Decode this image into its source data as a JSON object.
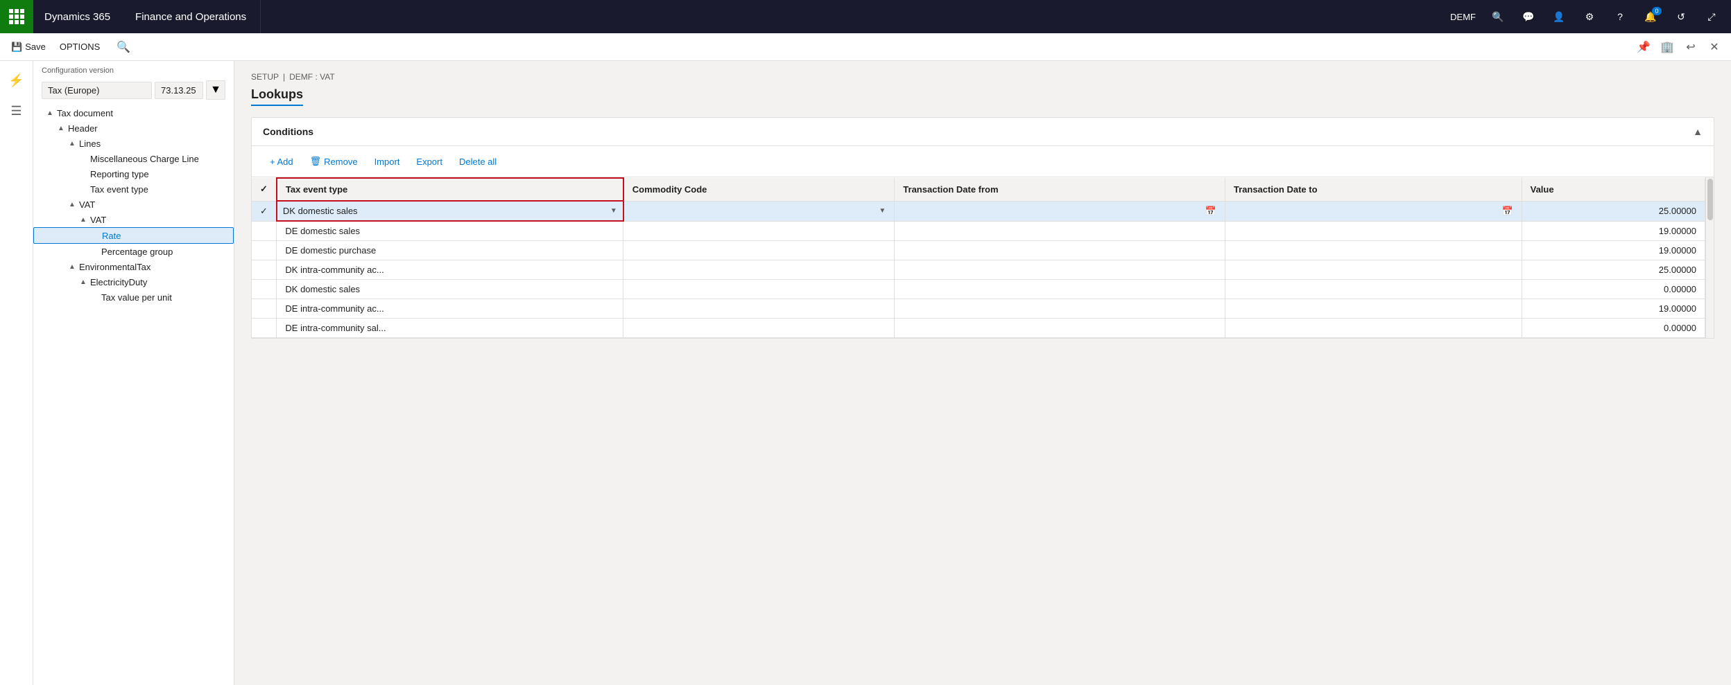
{
  "topNav": {
    "brand_d365": "Dynamics 365",
    "brand_app": "Finance and Operations",
    "demf": "DEMF",
    "notif_count": "0"
  },
  "toolbar": {
    "save_label": "Save",
    "options_label": "OPTIONS"
  },
  "treePanel": {
    "config_version_label": "Configuration version",
    "config_version_value": "Tax (Europe)",
    "config_version_number": "73.13.25",
    "items": [
      {
        "id": "tax-document",
        "label": "Tax document",
        "indent": 1,
        "expand": "▲",
        "selected": false
      },
      {
        "id": "header",
        "label": "Header",
        "indent": 2,
        "expand": "▲",
        "selected": false
      },
      {
        "id": "lines",
        "label": "Lines",
        "indent": 3,
        "expand": "▲",
        "selected": false
      },
      {
        "id": "misc-charge-line",
        "label": "Miscellaneous Charge Line",
        "indent": 4,
        "expand": "",
        "selected": false
      },
      {
        "id": "reporting-type",
        "label": "Reporting type",
        "indent": 4,
        "expand": "",
        "selected": false
      },
      {
        "id": "tax-event-type",
        "label": "Tax event type",
        "indent": 4,
        "expand": "",
        "selected": false
      },
      {
        "id": "vat",
        "label": "VAT",
        "indent": 3,
        "expand": "▲",
        "selected": false
      },
      {
        "id": "vat2",
        "label": "VAT",
        "indent": 4,
        "expand": "▲",
        "selected": false
      },
      {
        "id": "rate",
        "label": "Rate",
        "indent": 5,
        "expand": "",
        "selected": true
      },
      {
        "id": "percentage-group",
        "label": "Percentage group",
        "indent": 5,
        "expand": "",
        "selected": false
      },
      {
        "id": "environmental-tax",
        "label": "EnvironmentalTax",
        "indent": 3,
        "expand": "▲",
        "selected": false
      },
      {
        "id": "electricity-duty",
        "label": "ElectricityDuty",
        "indent": 4,
        "expand": "▲",
        "selected": false
      },
      {
        "id": "tax-value-per-unit",
        "label": "Tax value per unit",
        "indent": 5,
        "expand": "",
        "selected": false
      }
    ]
  },
  "breadcrumb": {
    "setup": "SETUP",
    "sep": "|",
    "path": "DEMF : VAT"
  },
  "pageTitle": "Lookups",
  "conditions": {
    "title": "Conditions",
    "actions": {
      "add": "+ Add",
      "remove": "Remove",
      "import": "Import",
      "export": "Export",
      "delete_all": "Delete all"
    },
    "columns": {
      "check": "",
      "tax_event_type": "Tax event type",
      "commodity_code": "Commodity Code",
      "transaction_date_from": "Transaction Date from",
      "transaction_date_to": "Transaction Date to",
      "value": "Value"
    },
    "rows": [
      {
        "id": 1,
        "tax_event_type": "DK domestic sales",
        "commodity_code": "",
        "tx_date_from": "",
        "tx_date_to": "",
        "value": "25.00000",
        "selected": true
      },
      {
        "id": 2,
        "tax_event_type": "DE domestic sales",
        "commodity_code": "",
        "tx_date_from": "",
        "tx_date_to": "",
        "value": "19.00000",
        "selected": false
      },
      {
        "id": 3,
        "tax_event_type": "DE domestic purchase",
        "commodity_code": "",
        "tx_date_from": "",
        "tx_date_to": "",
        "value": "19.00000",
        "selected": false
      },
      {
        "id": 4,
        "tax_event_type": "DK intra-community ac...",
        "commodity_code": "",
        "tx_date_from": "",
        "tx_date_to": "",
        "value": "25.00000",
        "selected": false
      },
      {
        "id": 5,
        "tax_event_type": "DK domestic sales",
        "commodity_code": "",
        "tx_date_from": "",
        "tx_date_to": "",
        "value": "0.00000",
        "selected": false
      },
      {
        "id": 6,
        "tax_event_type": "DE intra-community ac...",
        "commodity_code": "",
        "tx_date_from": "",
        "tx_date_to": "",
        "value": "19.00000",
        "selected": false
      },
      {
        "id": 7,
        "tax_event_type": "DE intra-community sal...",
        "commodity_code": "",
        "tx_date_from": "",
        "tx_date_to": "",
        "value": "0.00000",
        "selected": false
      }
    ]
  }
}
